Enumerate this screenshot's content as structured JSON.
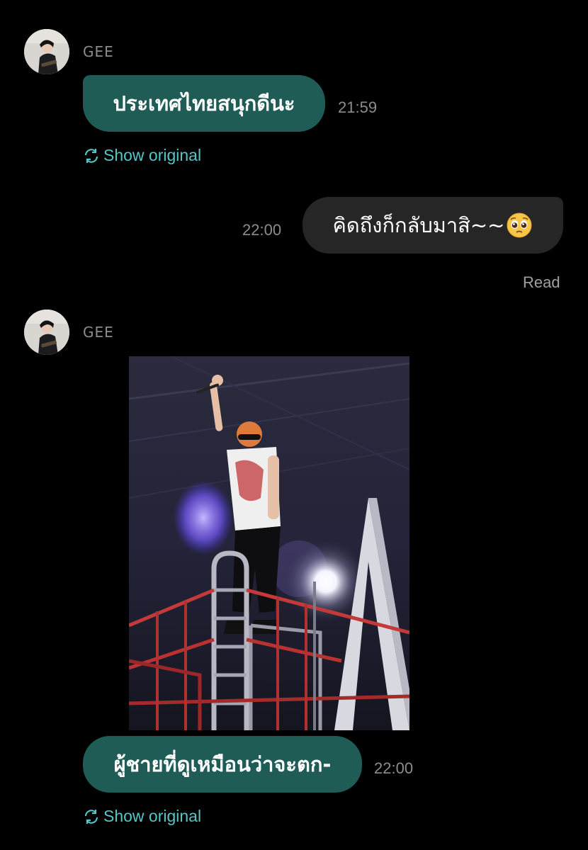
{
  "messages": [
    {
      "sender": "GEE",
      "text": "ประเทศไทยสนุกดีนะ",
      "time": "21:59",
      "translation_toggle": "Show original"
    },
    {
      "text": "คิดถึงก็กลับมาสิ~~",
      "emoji": "pleading-face",
      "time": "22:00",
      "status": "Read"
    },
    {
      "sender": "GEE",
      "attachment": "photo",
      "text": "ผู้ชายที่ดูเหมือนว่าจะตก-",
      "time": "22:00",
      "translation_toggle": "Show original"
    }
  ],
  "colors": {
    "background": "#000000",
    "incoming_bubble": "#1f5c55",
    "outgoing_bubble": "#262626",
    "link": "#54c6c6",
    "meta_text": "#8c8c8c"
  },
  "icons": {
    "translate": "translate-refresh-icon",
    "avatar": "avatar-photo"
  }
}
